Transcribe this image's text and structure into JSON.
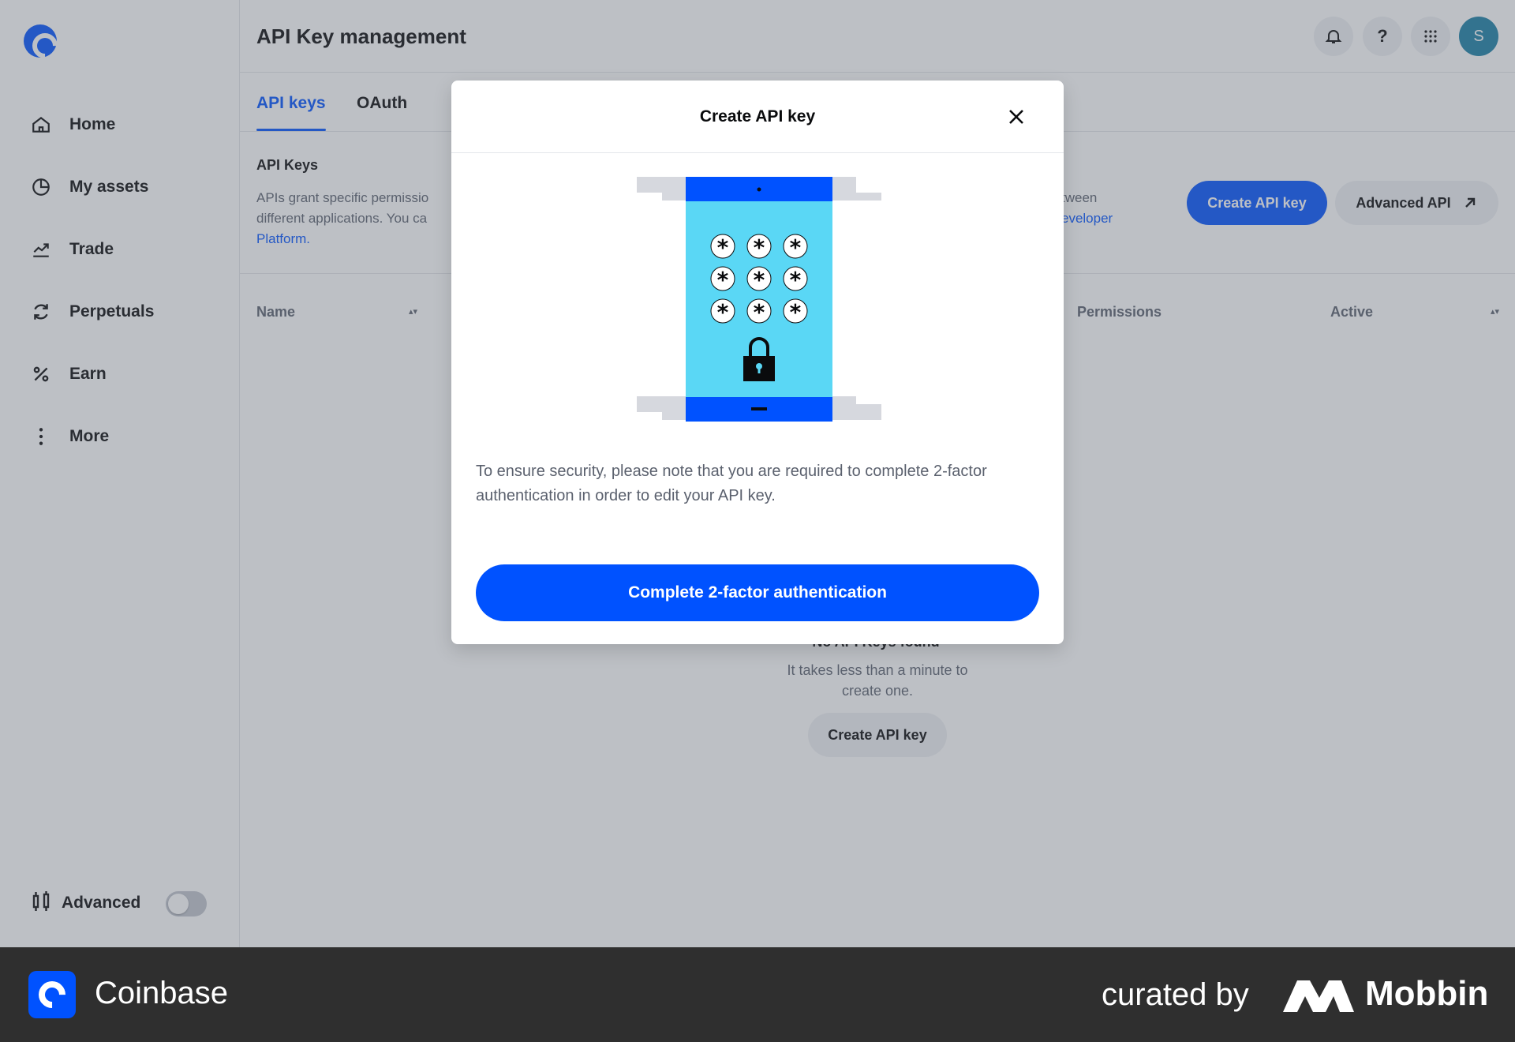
{
  "header": {
    "title": "API Key management"
  },
  "sidebar": {
    "items": [
      {
        "label": "Home",
        "icon": "home-icon"
      },
      {
        "label": "My assets",
        "icon": "pie-chart-icon"
      },
      {
        "label": "Trade",
        "icon": "trend-icon"
      },
      {
        "label": "Perpetuals",
        "icon": "refresh-icon"
      },
      {
        "label": "Earn",
        "icon": "percent-icon"
      },
      {
        "label": "More",
        "icon": "more-vertical-icon"
      }
    ],
    "advanced_label": "Advanced"
  },
  "header_actions": {
    "help": "?",
    "avatar_initial": "S"
  },
  "tabs": [
    {
      "label": "API keys",
      "active": true
    },
    {
      "label": "OAuth",
      "active": false
    }
  ],
  "section": {
    "title": "API Keys",
    "desc_line1": "APIs grant specific permissio",
    "desc_line2": "different applications. You ca",
    "desc_link": "Platform.",
    "desc_right_line1": "tween",
    "desc_right_link": "eveloper",
    "create_button": "Create API key",
    "advanced_button": "Advanced API"
  },
  "table": {
    "columns": [
      "Name",
      "Permissions",
      "Active"
    ]
  },
  "empty_state": {
    "title": "No API Keys found",
    "description": "It takes less than a minute to create one.",
    "button": "Create API key"
  },
  "modal": {
    "title": "Create API key",
    "text": "To ensure security, please note that you are required to complete 2-factor authentication in order to edit your API key.",
    "cta": "Complete 2-factor authentication"
  },
  "banner": {
    "brand": "Coinbase",
    "curated": "curated by",
    "curator": "Mobbin"
  },
  "colors": {
    "accent": "#0052ff",
    "phone_screen": "#5ad7f5",
    "banner_bg": "#2f2f2f"
  }
}
